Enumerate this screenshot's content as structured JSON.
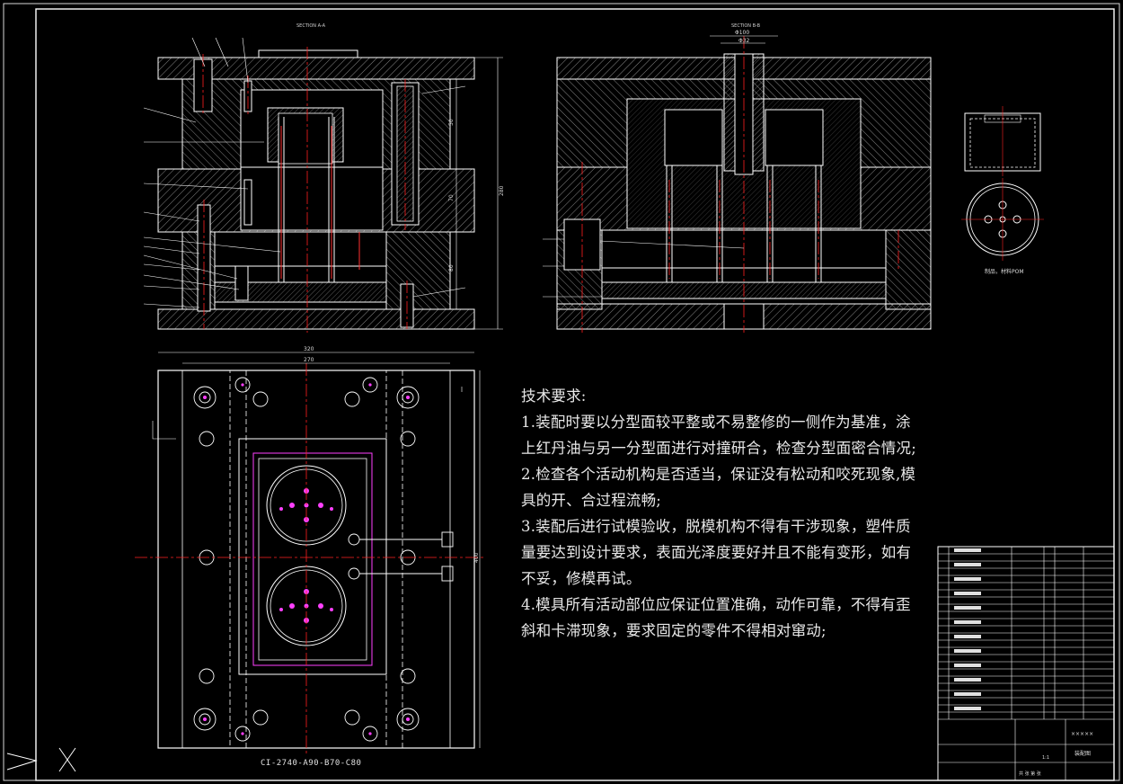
{
  "drawing": {
    "section_labels": [
      "SECTION A-A",
      "SECTION B-B"
    ],
    "dimensions": {
      "height_total": "280",
      "height_a": "50",
      "height_b": "70",
      "height_c": "80",
      "width_outer": "320",
      "width_inner": "270",
      "length": "400",
      "diameter_top": "Φ100",
      "diameter_inner": "Φ32"
    },
    "part_view_label": "制品，材料POM",
    "drawing_number": "CI-2740-A90-B70-C80",
    "title_block": {
      "company": "×××××",
      "title_cell": "装配图",
      "scale": "1:1",
      "sheet": "共 张 第 张"
    }
  },
  "requirements": {
    "heading": "技术要求:",
    "items": [
      "1.装配时要以分型面较平整或不易整修的一侧作为基准，涂上红丹油与另一分型面进行对撞研合，检查分型面密合情况;",
      "2.检查各个活动机构是否适当，保证没有松动和咬死现象,模具的开、合过程流畅;",
      "3.装配后进行试模验收，脱模机构不得有干涉现象，塑件质量要达到设计要求，表面光泽度要好并且不能有变形，如有不妥，修模再试。",
      "4.模具所有活动部位应保证位置准确，动作可靠，不得有歪斜和卡滞现象，要求固定的零件不得相对窜动;"
    ]
  },
  "colors": {
    "background": "#000000",
    "lines": "#ffffff",
    "centerline": "#ff2020",
    "highlight": "#ff40ff",
    "text": "#e8e8e8"
  }
}
